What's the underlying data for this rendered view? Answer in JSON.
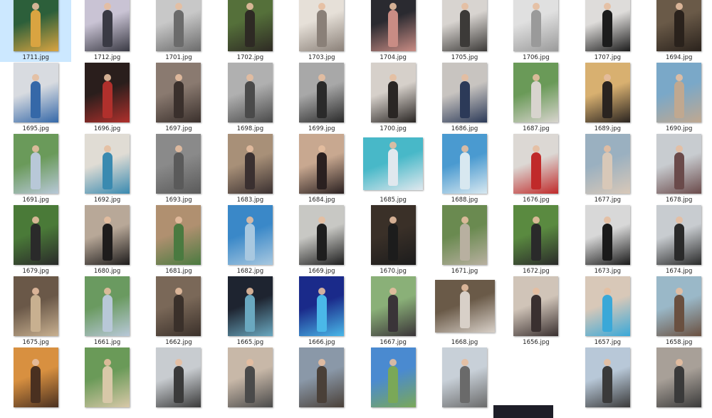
{
  "files": [
    {
      "name": "1711.jpg",
      "colors": [
        "#2c5f3a",
        "#d9a441"
      ],
      "selected": true
    },
    {
      "name": "1712.jpg",
      "colors": [
        "#c9c3d4",
        "#3a3a44"
      ]
    },
    {
      "name": "1701.jpg",
      "colors": [
        "#c8c8c8",
        "#6b6b6b"
      ]
    },
    {
      "name": "1702.jpg",
      "colors": [
        "#55703a",
        "#2e2a24"
      ]
    },
    {
      "name": "1703.jpg",
      "colors": [
        "#e6e0d8",
        "#8a8078"
      ]
    },
    {
      "name": "1704.jpg",
      "colors": [
        "#2a2a30",
        "#c98c84"
      ]
    },
    {
      "name": "1705.jpg",
      "colors": [
        "#d8d4d0",
        "#3c3a38"
      ]
    },
    {
      "name": "1706.jpg",
      "colors": [
        "#e0e0e0",
        "#9a9a9a"
      ]
    },
    {
      "name": "1707.jpg",
      "colors": [
        "#dedcda",
        "#1c1c1c"
      ]
    },
    {
      "name": "1694.jpg",
      "colors": [
        "#6a5a48",
        "#2a221c"
      ]
    },
    {
      "name": "1695.jpg",
      "colors": [
        "#d8dbe0",
        "#3568a8"
      ]
    },
    {
      "name": "1696.jpg",
      "colors": [
        "#2a1e1c",
        "#b0302c"
      ]
    },
    {
      "name": "1697.jpg",
      "colors": [
        "#8a7a70",
        "#3a302c"
      ]
    },
    {
      "name": "1698.jpg",
      "colors": [
        "#b0b0b0",
        "#4a4a4a"
      ]
    },
    {
      "name": "1699.jpg",
      "colors": [
        "#a8a8a8",
        "#2a2a2a"
      ]
    },
    {
      "name": "1700.jpg",
      "colors": [
        "#d6d0ca",
        "#2a2624"
      ]
    },
    {
      "name": "1686.jpg",
      "colors": [
        "#c8c4c0",
        "#2c3a58"
      ]
    },
    {
      "name": "1687.jpg",
      "colors": [
        "#6a9a58",
        "#d8d4ce"
      ]
    },
    {
      "name": "1689.jpg",
      "colors": [
        "#d8b070",
        "#2a2420"
      ]
    },
    {
      "name": "1690.jpg",
      "colors": [
        "#7aa8c8",
        "#c0a890"
      ]
    },
    {
      "name": "1691.jpg",
      "colors": [
        "#6a9a5a",
        "#b8c8d8"
      ]
    },
    {
      "name": "1692.jpg",
      "colors": [
        "#e0dcd4",
        "#3a8ab0"
      ]
    },
    {
      "name": "1693.jpg",
      "colors": [
        "#8a8a8a",
        "#5a5a5a"
      ]
    },
    {
      "name": "1683.jpg",
      "colors": [
        "#a89078",
        "#3a3030"
      ]
    },
    {
      "name": "1684.jpg",
      "colors": [
        "#c8a890",
        "#2a2020"
      ]
    },
    {
      "name": "1685.jpg",
      "colors": [
        "#48b8c8",
        "#e0e8ee"
      ],
      "wide": true
    },
    {
      "name": "1688.jpg",
      "colors": [
        "#4a9ad0",
        "#d8e8f0"
      ]
    },
    {
      "name": "1676.jpg",
      "colors": [
        "#dcd8d4",
        "#c02a2a"
      ]
    },
    {
      "name": "1677.jpg",
      "colors": [
        "#9ab0c0",
        "#d8c8b8"
      ]
    },
    {
      "name": "1678.jpg",
      "colors": [
        "#c8ccd0",
        "#6a4a4a"
      ]
    },
    {
      "name": "1679.jpg",
      "colors": [
        "#4a7a38",
        "#2a2a2a"
      ]
    },
    {
      "name": "1680.jpg",
      "colors": [
        "#b8a898",
        "#1e1c1c"
      ]
    },
    {
      "name": "1681.jpg",
      "colors": [
        "#b09070",
        "#4a7a40"
      ]
    },
    {
      "name": "1682.jpg",
      "colors": [
        "#3a88c8",
        "#a8c8e0"
      ]
    },
    {
      "name": "1669.jpg",
      "colors": [
        "#c8c8c4",
        "#1e1e1e"
      ]
    },
    {
      "name": "1670.jpg",
      "colors": [
        "#3a3028",
        "#1c1c1c"
      ]
    },
    {
      "name": "1671.jpg",
      "colors": [
        "#6a8a50",
        "#b8b0a0"
      ]
    },
    {
      "name": "1672.jpg",
      "colors": [
        "#5a8a40",
        "#2a2a2a"
      ]
    },
    {
      "name": "1673.jpg",
      "colors": [
        "#d8d8d8",
        "#1a1a1a"
      ]
    },
    {
      "name": "1674.jpg",
      "colors": [
        "#c8ccd0",
        "#2a2a2a"
      ]
    },
    {
      "name": "1675.jpg",
      "colors": [
        "#6a5848",
        "#c8b090"
      ]
    },
    {
      "name": "1661.jpg",
      "colors": [
        "#6a9a60",
        "#b8c8d8"
      ]
    },
    {
      "name": "1662.jpg",
      "colors": [
        "#7a6858",
        "#3a302a"
      ]
    },
    {
      "name": "1665.jpg",
      "colors": [
        "#1e2430",
        "#6aa8c0"
      ]
    },
    {
      "name": "1666.jpg",
      "colors": [
        "#1a2a8a",
        "#4ab8e8"
      ]
    },
    {
      "name": "1667.jpg",
      "colors": [
        "#8ab078",
        "#3a3438"
      ]
    },
    {
      "name": "1668.jpg",
      "colors": [
        "#6a5a48",
        "#d8d0c8"
      ],
      "wide": true
    },
    {
      "name": "1656.jpg",
      "colors": [
        "#d0c4b8",
        "#3a3030"
      ]
    },
    {
      "name": "1657.jpg",
      "colors": [
        "#d8c8b8",
        "#3aa8d8"
      ]
    },
    {
      "name": "1658.jpg",
      "colors": [
        "#9ab8c8",
        "#6a5040"
      ]
    },
    {
      "name": "",
      "colors": [
        "#d89040",
        "#4a3020"
      ]
    },
    {
      "name": "",
      "colors": [
        "#6a9a58",
        "#d8c8a8"
      ]
    },
    {
      "name": "",
      "colors": [
        "#c8ccd0",
        "#3a3a3a"
      ]
    },
    {
      "name": "",
      "colors": [
        "#c8b8a8",
        "#4a4a4a"
      ]
    },
    {
      "name": "",
      "colors": [
        "#8a98a8",
        "#4a4038"
      ]
    },
    {
      "name": "",
      "colors": [
        "#4a8ad0",
        "#7aa858"
      ]
    },
    {
      "name": "",
      "colors": [
        "#c8d0d8",
        "#6a6a6a"
      ]
    },
    {
      "name": "",
      "colors": [
        "#ffffff",
        "#ffffff"
      ],
      "blank": true
    },
    {
      "name": "",
      "colors": [
        "#b8c8d8",
        "#3a3a3a"
      ]
    },
    {
      "name": "",
      "colors": [
        "#a8a098",
        "#3a3a3a"
      ]
    }
  ],
  "dark_strip_color": "#1e1e28"
}
